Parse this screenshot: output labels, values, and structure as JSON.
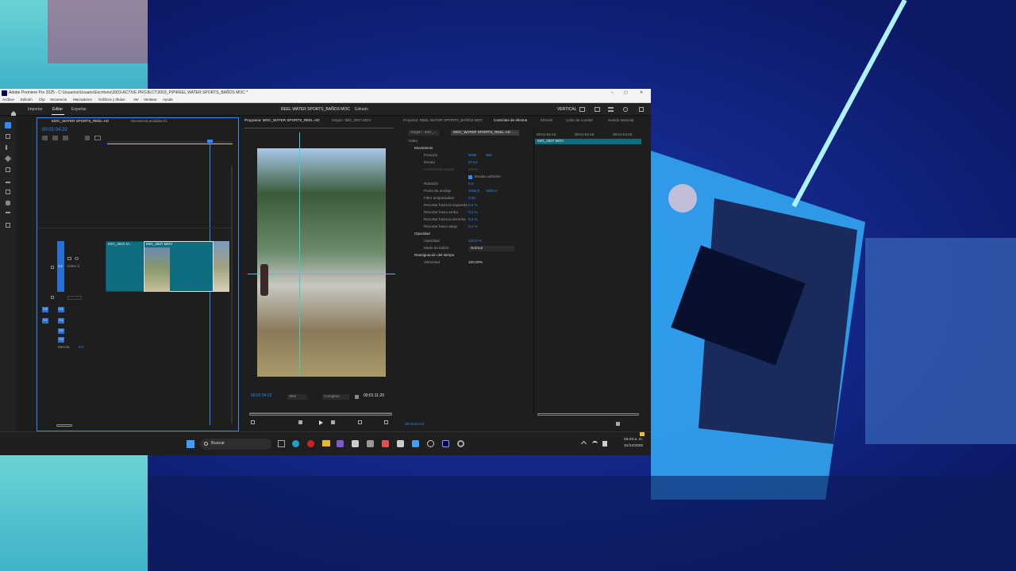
{
  "window": {
    "title": "Adobe Premiere Pro 2025 - C:\\Usuarios\\Usuario\\Escritorio\\2003-ACTIVE PROJECT\\2003_P\\P\\REEL WATER SPORTS_BAÑOS MOC *",
    "controls": {
      "minimize": "–",
      "maximize": "▢",
      "close": "✕"
    }
  },
  "menu": [
    "Archivo",
    "Edición",
    "Clip",
    "Secuencia",
    "Marcadores",
    "Gráficos y títulos",
    "Ver",
    "Ventana",
    "Ayuda"
  ],
  "workspace": {
    "tabs": [
      "Importar",
      "Editar",
      "Exportar"
    ],
    "active": "Editar",
    "title": "REEL WATER SPORTS_BAÑOS MOC",
    "status": "Editado",
    "layout": "VERTICAL"
  },
  "timeline": {
    "tabs": [
      "MOC_WATER SPORTS_REEL-AD",
      "Secuencia anidada 01"
    ],
    "timecode": "00:01:04:22",
    "tracks": {
      "v3": "V3",
      "v2": "V2",
      "v1": "V1",
      "a1": "A1",
      "a2": "A2",
      "a3": "A3",
      "mix": "Mezcla",
      "mix_value": "0,0",
      "video_name": "Vídeo 3"
    },
    "clips": [
      "IMG_3502.M...",
      "IMG_3507.MOV"
    ]
  },
  "program": {
    "tabs": [
      "Programa: MOC_WATER SPORTS_REEL-AD",
      "Origen: IMG_3507.MOV"
    ],
    "timecode": "00:01:04:22",
    "zoom": "35%",
    "quality": "Completo",
    "duration": "00:01:11:20"
  },
  "right_tabs": [
    "Proyecto: REEL WATER SPORTS_BAÑOS MOC",
    "Controles de efectos",
    "Efectos",
    "Color de Lumetri",
    "Sonido esencial"
  ],
  "effects": {
    "source_tab": "Origen - IMG_...",
    "seq_tab": "MOC_WATER SPORTS_REEL-AD - ...",
    "section_video": "Vídeo",
    "clip_label": "IMG_3507.MOV",
    "ruler": [
      "00:01:04:10",
      "00:01:04:15",
      "00:01:04:20"
    ],
    "rows": [
      {
        "name": "Movimiento",
        "value": "",
        "value2": "",
        "header": true
      },
      {
        "name": "Posición",
        "value": "5090",
        "value2": "960",
        "header": false
      },
      {
        "name": "Escala",
        "value": "273,0",
        "value2": "",
        "header": false
      },
      {
        "name": "Anchura de escala",
        "value": "100,0",
        "value2": "",
        "header": false
      },
      {
        "name": "Escala uniforme",
        "value": "",
        "value2": "",
        "header": false
      },
      {
        "name": "Rotación",
        "value": "0,0",
        "value2": "",
        "header": false
      },
      {
        "name": "Punto de anclaje",
        "value": "1080,0",
        "value2": "1920,0",
        "header": false
      },
      {
        "name": "Filtro antiparpadeo",
        "value": "0,00",
        "value2": "",
        "header": false
      },
      {
        "name": "Recortar hacia la izquierda",
        "value": "0,0 %",
        "value2": "",
        "header": false
      },
      {
        "name": "Recortar hacia arriba",
        "value": "0,0 %",
        "value2": "",
        "header": false
      },
      {
        "name": "Recortar hacia la derecha",
        "value": "0,0 %",
        "value2": "",
        "header": false
      },
      {
        "name": "Recortar hacia abajo",
        "value": "0,0 %",
        "value2": "",
        "header": false
      },
      {
        "name": "Opacidad",
        "value": "",
        "value2": "",
        "header": true
      },
      {
        "name": "Opacidad",
        "value": "100,0 %",
        "value2": "",
        "header": false
      },
      {
        "name": "Modo de fusión",
        "value": "Normal",
        "value2": "",
        "header": false
      },
      {
        "name": "Reasignación del tiempo",
        "value": "",
        "value2": "",
        "header": true
      },
      {
        "name": "Velocidad",
        "value": "100,00%",
        "value2": "",
        "header": false
      }
    ],
    "footer_timecode": "00:01:04:22"
  },
  "taskbar": {
    "search": "Buscar",
    "time": "03:33 a. m.",
    "date": "31/12/2025"
  },
  "colors": {
    "accent": "#2f8bff",
    "clip": "#0f6d80",
    "window_bg": "#1d1d1d"
  }
}
